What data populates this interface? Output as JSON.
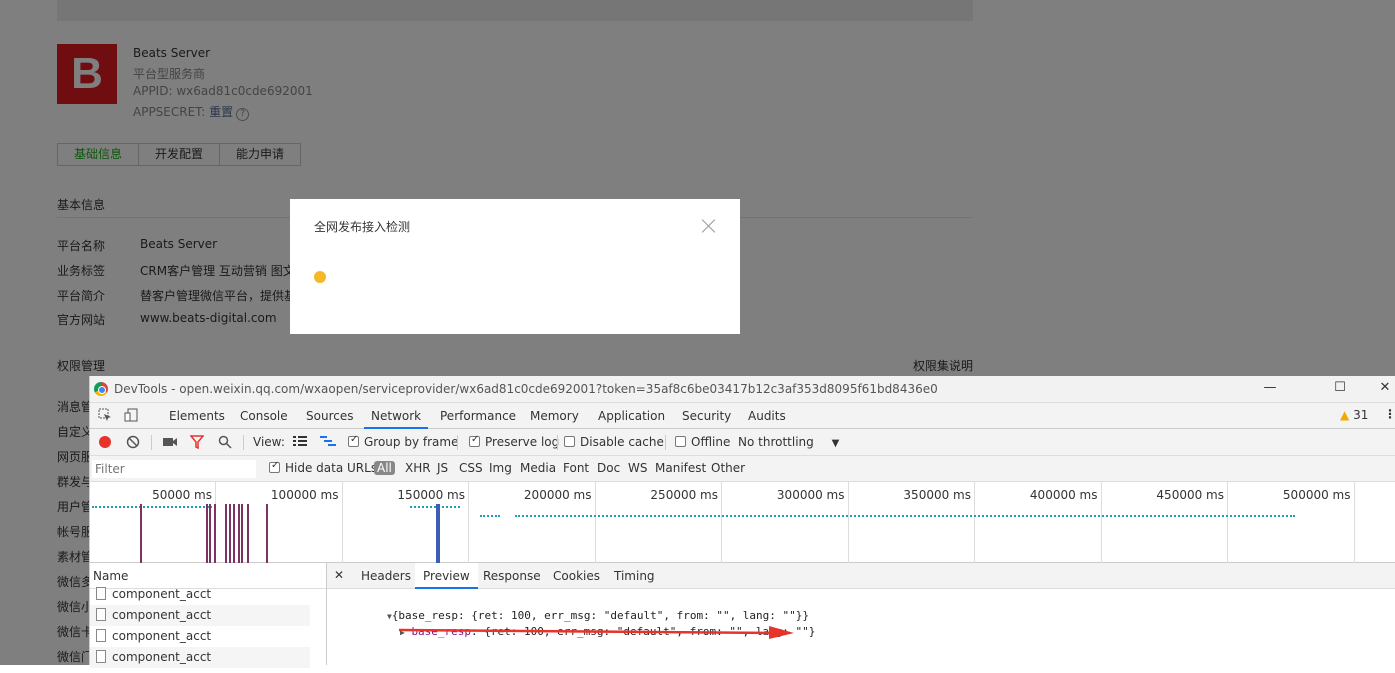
{
  "account": {
    "logo_letter": "B",
    "name": "Beats Server",
    "type": "平台型服务商",
    "appid": "APPID: wx6ad81c0cde692001",
    "appsecret_label": "APPSECRET: ",
    "appsecret_link": "重置",
    "help_glyph": "?"
  },
  "tabs": [
    "基础信息",
    "开发配置",
    "能力申请"
  ],
  "basic_info": {
    "title": "基本信息",
    "rows": [
      {
        "label": "平台名称",
        "value": "Beats Server"
      },
      {
        "label": "业务标签",
        "value": "CRM客户管理 互动营销 图文"
      },
      {
        "label": "平台简介",
        "value": "替客户管理微信平台，提供基"
      },
      {
        "label": "官方网站",
        "value": "www.beats-digital.com"
      }
    ]
  },
  "permissions": {
    "title": "权限管理",
    "link": "权限集说明",
    "items": [
      "消息管理",
      "自定义菜单",
      "网页服务",
      "群发与通知",
      "用户管理",
      "帐号服务",
      "素材管理",
      "微信多客服",
      "微信小店",
      "微信卡券",
      "微信门店"
    ]
  },
  "dialog": {
    "title": "全网发布接入检测",
    "close_icon": "close-icon",
    "status_color": "#f5b828"
  },
  "devtools": {
    "title": "DevTools - open.weixin.qq.com/wxaopen/serviceprovider/wx6ad81c0cde692001?token=35af8c6be03417b12c3af353d8095f61bd8436e0",
    "window_buttons": {
      "minimize": "—",
      "maximize": "☐",
      "close": "✕"
    },
    "panel_tabs": [
      "Elements",
      "Console",
      "Sources",
      "Network",
      "Performance",
      "Memory",
      "Application",
      "Security",
      "Audits"
    ],
    "active_panel": "Network",
    "warning_count": "31",
    "toolbar": {
      "view_label": "View:",
      "group_by_frame": "Group by frame",
      "preserve_log": "Preserve log",
      "disable_cache": "Disable cache",
      "offline": "Offline",
      "throttling": "No throttling"
    },
    "filter": {
      "placeholder": "Filter",
      "hide_data_urls": "Hide data URLs",
      "types": [
        "All",
        "XHR",
        "JS",
        "CSS",
        "Img",
        "Media",
        "Font",
        "Doc",
        "WS",
        "Manifest",
        "Other"
      ]
    },
    "timeline_ticks": [
      "50000 ms",
      "100000 ms",
      "150000 ms",
      "200000 ms",
      "250000 ms",
      "300000 ms",
      "350000 ms",
      "400000 ms",
      "450000 ms",
      "500000 ms"
    ],
    "name_column": {
      "header": "Name",
      "rows": [
        "component_acct",
        "component_acct",
        "component_acct",
        "component_acct"
      ]
    },
    "detail_tabs": [
      "Headers",
      "Preview",
      "Response",
      "Cookies",
      "Timing"
    ],
    "active_detail_tab": "Preview",
    "preview": {
      "line1": "{base_resp: {ret: 100, err_msg: \"default\", from: \"\", lang: \"\"}}",
      "line2_key": "base_resp",
      "line2_rest": ": {ret: 100, err_msg: \"default\", from: \"\", lang: \"\"}"
    },
    "annotation_color": "#e8332a"
  }
}
